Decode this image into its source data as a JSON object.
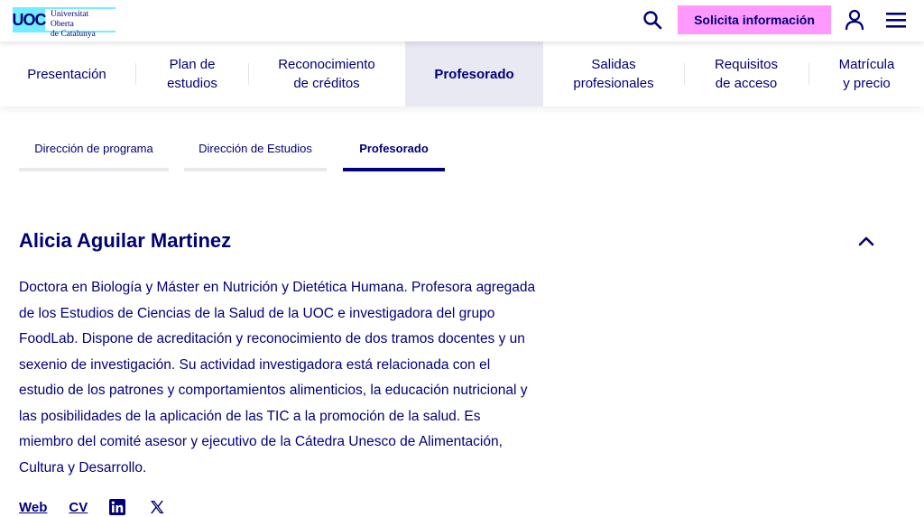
{
  "header": {
    "logo_mark": "UOC",
    "logo_line1": "Universitat Oberta",
    "logo_line2": "de Catalunya",
    "cta_label": "Solicita información",
    "icons": [
      "search-icon",
      "user-icon",
      "menu-icon"
    ]
  },
  "section_nav": {
    "items": [
      {
        "label": "Presentación"
      },
      {
        "label": "Plan de\nestudios"
      },
      {
        "label": "Reconocimiento\nde créditos"
      },
      {
        "label": "Profesorado",
        "active": true
      },
      {
        "label": "Salidas\nprofesionales"
      },
      {
        "label": "Requisitos\nde acceso"
      },
      {
        "label": "Matrícula\ny precio"
      }
    ]
  },
  "sub_tabs": {
    "items": [
      {
        "label": "Dirección de programa"
      },
      {
        "label": "Dirección de Estudios"
      },
      {
        "label": "Profesorado",
        "active": true
      }
    ]
  },
  "profile": {
    "name": "Alicia Aguilar Martinez",
    "bio": "Doctora en Biología y Máster en Nutrición y Dietética Humana. Profesora agregada de los Estudios de Ciencias de la Salud de la UOC e investigadora del grupo FoodLab. Dispone de acreditación y reconocimiento de dos tramos docentes y un sexenio de investigación. Su actividad investigadora está relacionada con el estudio de los patrones y comportamientos alimenticios, la educación nutricional y las posibilidades de la aplicación de las TIC a la promoción de la salud. Es miembro del comité asesor y ejecutivo de la Cátedra Unesco de Alimentación, Cultura y Desarrollo.",
    "link_web": "Web",
    "link_cv": "CV",
    "social_icons": [
      "linkedin-icon",
      "x-twitter-icon"
    ]
  },
  "colors": {
    "brand_navy": "#000078",
    "brand_cyan": "#73edff",
    "cta_pink": "#ff99ff",
    "active_tab_bg": "#e9e9f3"
  }
}
